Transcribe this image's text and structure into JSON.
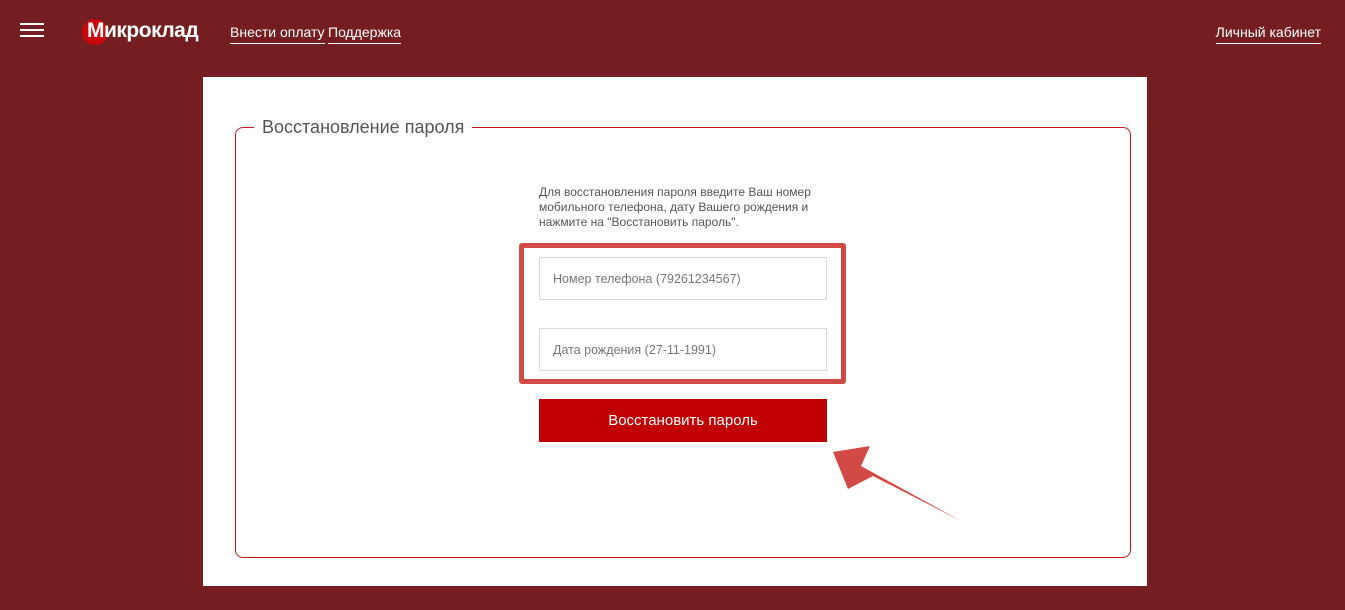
{
  "header": {
    "logo_text": "Микроклад",
    "nav": {
      "pay": "Внести оплату",
      "support": "Поддержка",
      "cabinet": "Личный кабинет"
    }
  },
  "form": {
    "legend": "Восстановление пароля",
    "instructions": "Для восстановления пароля введите Ваш номер мобильного телефона, дату Вашего рождения и нажмите на \"Восстановить пароль\".",
    "phone": {
      "value": "",
      "placeholder": "Номер телефона (79261234567)"
    },
    "birthdate": {
      "value": "",
      "placeholder": "Дата рождения (27-11-1991)"
    },
    "submit_label": "Восстановить пароль"
  },
  "icons": {
    "menu": "hamburger-menu-icon",
    "logo": "logo-circle-icon",
    "annotation": "arrow-icon"
  },
  "colors": {
    "background": "#741e22",
    "accent": "#c00003",
    "border": "#c5161d",
    "annotation": "#d24a45"
  }
}
